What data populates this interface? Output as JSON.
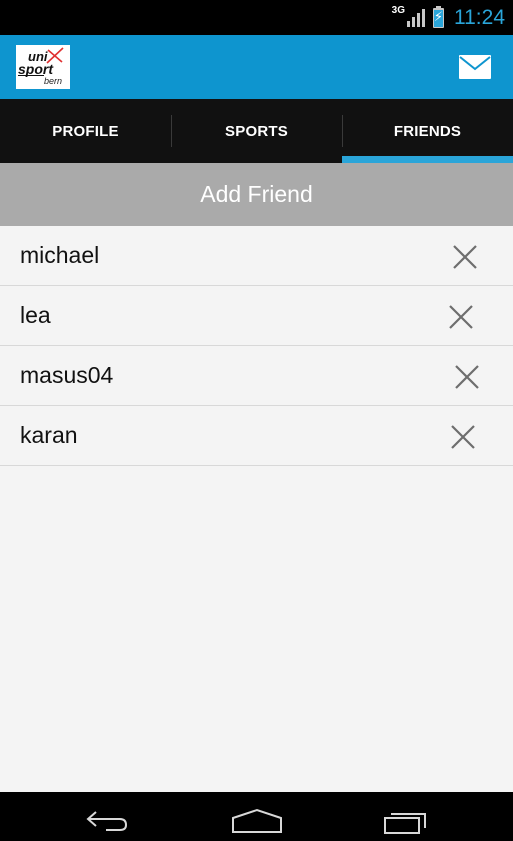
{
  "status_bar": {
    "network": "3G",
    "time": "11:24",
    "colors": {
      "accent": "#2aa5d9"
    }
  },
  "action_bar": {
    "logo": {
      "line1": "uni",
      "line2": "sport",
      "line3": "bern"
    },
    "mail_icon": "mail-icon",
    "color": "#0e95cf"
  },
  "tabs": [
    {
      "label": "PROFILE",
      "active": false
    },
    {
      "label": "SPORTS",
      "active": false
    },
    {
      "label": "FRIENDS",
      "active": true
    }
  ],
  "add_friend": {
    "label": "Add Friend"
  },
  "friends": [
    {
      "name": "michael",
      "remove_icon": "close-icon"
    },
    {
      "name": "lea",
      "remove_icon": "close-icon"
    },
    {
      "name": "masus04",
      "remove_icon": "close-icon"
    },
    {
      "name": "karan",
      "remove_icon": "close-icon"
    }
  ],
  "nav_bar": {
    "buttons": [
      "back-icon",
      "home-icon",
      "recent-apps-icon"
    ]
  }
}
